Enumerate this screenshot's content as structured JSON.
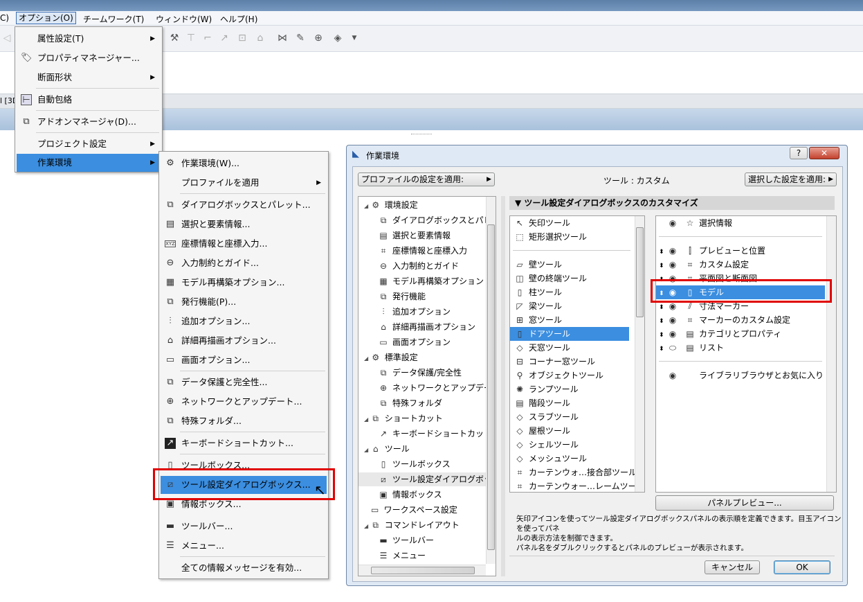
{
  "menubar": {
    "left_fragment": "C)",
    "items": [
      "オプション(O)",
      "チームワーク(T)",
      "ウィンドウ(W)",
      "ヘルプ(H)"
    ]
  },
  "tab_fragment": "l [3D",
  "options_menu": {
    "items": [
      {
        "label": "属性設定(T)",
        "icon": "",
        "submenu": true
      },
      {
        "label": "プロパティマネージャー...",
        "icon": "tag-icon",
        "submenu": false
      },
      {
        "label": "断面形状",
        "icon": "",
        "submenu": true
      },
      {
        "label": "自動包絡",
        "icon": "auto-trim-icon",
        "submenu": false
      },
      {
        "label": "アドオンマネージャ(D)...",
        "icon": "puzzle-icon",
        "submenu": false
      },
      {
        "label": "プロジェクト設定",
        "icon": "",
        "submenu": true
      },
      {
        "label": "作業環境",
        "icon": "",
        "submenu": true
      }
    ]
  },
  "work_env_menu": {
    "items": [
      {
        "label": "作業環境(W)...",
        "icon": "work-env-icon"
      },
      {
        "label": "プロファイルを適用",
        "icon": "",
        "submenu": true
      },
      {
        "label": "ダイアログボックスとパレット...",
        "icon": "dialog-palette-icon"
      },
      {
        "label": "選択と要素情報...",
        "icon": "selection-info-icon"
      },
      {
        "label": "座標情報と座標入力...",
        "icon": "xyz-icon"
      },
      {
        "label": "入力制約とガイド...",
        "icon": "constraint-icon"
      },
      {
        "label": "モデル再構築オプション...",
        "icon": "rebuild-icon"
      },
      {
        "label": "発行機能(P)...",
        "icon": "publish-icon"
      },
      {
        "label": "追加オプション...",
        "icon": "sliders-icon"
      },
      {
        "label": "詳細再描画オプション...",
        "icon": "redraw-icon"
      },
      {
        "label": "画面オプション...",
        "icon": "monitor-icon"
      },
      {
        "label": "データ保護と完全性...",
        "icon": "data-safety-icon"
      },
      {
        "label": "ネットワークとアップデート...",
        "icon": "globe-icon"
      },
      {
        "label": "特殊フォルダ...",
        "icon": "folder-icon"
      },
      {
        "label": "キーボードショートカット...",
        "icon": "shortcut-icon"
      },
      {
        "label": "ツールボックス...",
        "icon": "toolbox-icon"
      },
      {
        "label": "ツール設定ダイアログボックス...",
        "icon": "tool-settings-icon"
      },
      {
        "label": "情報ボックス...",
        "icon": "info-box-icon"
      },
      {
        "label": "ツールバー...",
        "icon": "toolbar-icon"
      },
      {
        "label": "メニュー...",
        "icon": "menu-icon"
      },
      {
        "label": "全ての情報メッセージを有効...",
        "icon": ""
      }
    ]
  },
  "dialog": {
    "title": "作業環境",
    "help_button": "?",
    "close_button": "✕",
    "profile_apply": "プロファイルの設定を適用:",
    "tool_label": "ツール : カスタム",
    "selected_apply": "選択した設定を適用:",
    "tree": [
      {
        "label": "環境設定",
        "level": 0
      },
      {
        "label": "ダイアログボックスとパレット",
        "level": 1
      },
      {
        "label": "選択と要素情報",
        "level": 1
      },
      {
        "label": "座標情報と座標入力",
        "level": 1
      },
      {
        "label": "入力制約とガイド",
        "level": 1
      },
      {
        "label": "モデル再構築オプション",
        "level": 1
      },
      {
        "label": "発行機能",
        "level": 1
      },
      {
        "label": "追加オプション",
        "level": 1
      },
      {
        "label": "詳細再描画オプション",
        "level": 1
      },
      {
        "label": "画面オプション",
        "level": 1
      },
      {
        "label": "標準設定",
        "level": 0
      },
      {
        "label": "データ保護/完全性",
        "level": 1
      },
      {
        "label": "ネットワークとアップデート",
        "level": 1
      },
      {
        "label": "特殊フォルダ",
        "level": 1
      },
      {
        "label": "ショートカット",
        "level": 0
      },
      {
        "label": "キーボードショートカット",
        "level": 1
      },
      {
        "label": "ツール",
        "level": 0
      },
      {
        "label": "ツールボックス",
        "level": 1
      },
      {
        "label": "ツール設定ダイアログボックス",
        "level": 1
      },
      {
        "label": "情報ボックス",
        "level": 1
      },
      {
        "label": "ワークスペース設定",
        "level": 0
      },
      {
        "label": "コマンドレイアウト",
        "level": 0
      },
      {
        "label": "ツールバー",
        "level": 1
      },
      {
        "label": "メニュー",
        "level": 1
      }
    ],
    "section_header": "ツール設定ダイアログボックスのカスタマイズ",
    "tools_top": [
      "矢印ツール",
      "矩形選択ツール"
    ],
    "tools": [
      "壁ツール",
      "壁の終端ツール",
      "柱ツール",
      "梁ツール",
      "窓ツール",
      "ドアツール",
      "天窓ツール",
      "コーナー窓ツール",
      "オブジェクトツール",
      "ランプツール",
      "階段ツール",
      "スラブツール",
      "屋根ツール",
      "シェルツール",
      "メッシュツール",
      "カーテンウォ…接合部ツール",
      "カーテンウォー…レームツール"
    ],
    "panels_top": [
      "選択情報"
    ],
    "panels": [
      "プレビューと位置",
      "カスタム設定",
      "平面図と断面図",
      "モデル",
      "寸法マーカー",
      "マーカーのカスタム設定",
      "カテゴリとプロパティ",
      "リスト"
    ],
    "panels_bottom": [
      "ライブラリブラウザとお気に入り"
    ],
    "panel_preview_button": "パネルプレビュー...",
    "description": [
      "矢印アイコンを使ってツール設定ダイアログボックスパネルの表示順を定義できます。目玉アイコンを使ってパネ",
      "ルの表示方法を制御できます。",
      "パネル名をダブルクリックするとパネルのプレビューが表示されます。"
    ],
    "cancel": "キャンセル",
    "ok": "OK"
  },
  "colors": {
    "highlight": "#3b8ee0",
    "red_box": "#e00000"
  }
}
